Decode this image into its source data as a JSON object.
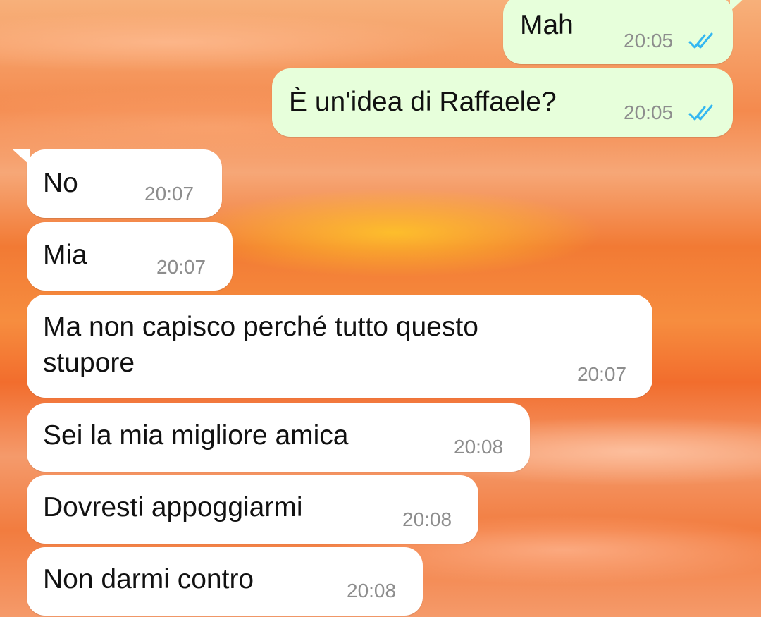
{
  "messages": [
    {
      "direction": "out",
      "text": "Mah",
      "time": "20:05",
      "status": "read-double-check-icon"
    },
    {
      "direction": "out",
      "text": "È un'idea di Raffaele?",
      "time": "20:05",
      "status": "read-double-check-icon"
    },
    {
      "direction": "in",
      "text": "No",
      "time": "20:07"
    },
    {
      "direction": "in",
      "text": "Mia",
      "time": "20:07"
    },
    {
      "direction": "in",
      "text_line1": "Ma non capisco perché tutto questo",
      "text_line2": "stupore",
      "time": "20:07"
    },
    {
      "direction": "in",
      "text": "Sei la mia migliore amica",
      "time": "20:08"
    },
    {
      "direction": "in",
      "text": "Dovresti appoggiarmi",
      "time": "20:08"
    },
    {
      "direction": "in",
      "text": "Non darmi contro",
      "time": "20:08"
    }
  ],
  "colors": {
    "outgoing_bubble": "#e7ffdb",
    "incoming_bubble": "#ffffff",
    "read_ticks": "#34b7f1",
    "timestamp": "#8d8d8d"
  }
}
